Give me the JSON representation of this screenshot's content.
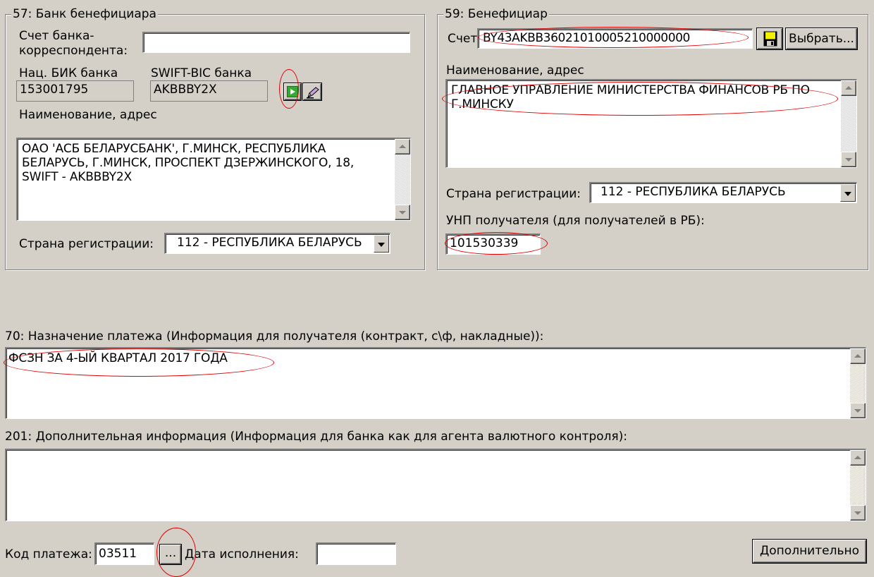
{
  "bank_beneficiary": {
    "title": "57: Банк бенефициара",
    "corr_account_label": "Счет банка-\nкорреспондента:",
    "corr_account_value": "",
    "bik_label": "Нац. БИК банка",
    "bik_value": "153001795",
    "swift_label": "SWIFT-BIC банка",
    "swift_value": "AKBBBY2X",
    "name_label": "Наименование, адрес",
    "name_value": "ОАО 'АСБ БЕЛАРУСБАНК', Г.МИНСК, РЕСПУБЛИКА БЕЛАРУСЬ, Г.МИНСК, ПРОСПЕКТ ДЗЕРЖИНСКОГО, 18, SWIFT - AKBBBY2X",
    "country_label": "Страна регистрации:",
    "country_value": "112 - РЕСПУБЛИКА БЕЛАРУСЬ"
  },
  "beneficiary": {
    "title": "59: Бенефициар",
    "account_label": "Счет:",
    "account_value": "BY43AKBB36021010005210000000",
    "select_label": "Выбрать...",
    "name_label": "Наименование, адрес",
    "name_value": "ГЛАВНОЕ УПРАВЛЕНИЕ МИНИСТЕРСТВА ФИНАНСОВ РБ ПО Г.МИНСКУ",
    "country_label": "Страна регистрации:",
    "country_value": "112 - РЕСПУБЛИКА БЕЛАРУСЬ",
    "unp_label": "УНП получателя (для получателей в РБ):",
    "unp_value": "101530339"
  },
  "purpose": {
    "label": "70: Назначение платежа (Информация для получателя (контракт, с\\ф, накладные)):",
    "value": "ФСЗН ЗА 4-ЫЙ КВАРТАЛ 2017 ГОДА"
  },
  "additional_info": {
    "label": "201: Дополнительная информация (Информация для банка как для агента валютного контроля):",
    "value": ""
  },
  "footer": {
    "payment_code_label": "Код платежа:",
    "payment_code_value": "03511",
    "browse_label": "...",
    "exec_date_label": "Дата исполнения:",
    "exec_date_value": "",
    "more_label": "Дополнительно"
  },
  "colors": {
    "window_bg": "#d4d0c8",
    "annotation_red": "#e00000",
    "go_green": "#33aa33"
  }
}
